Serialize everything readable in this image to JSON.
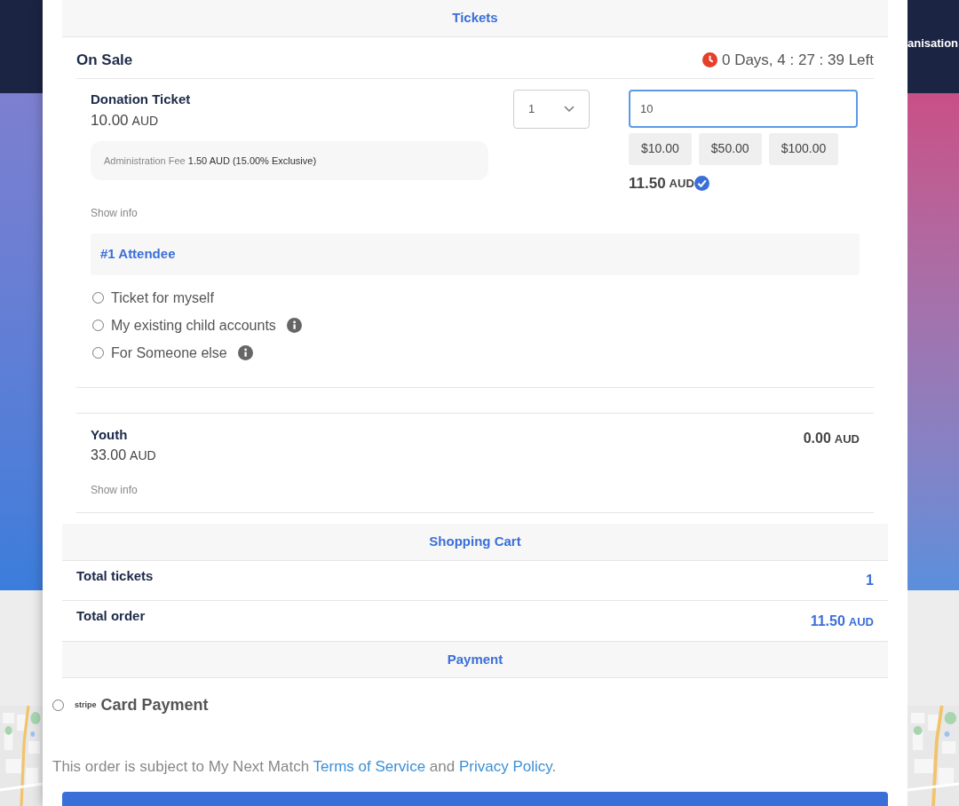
{
  "background": {
    "nav_text": "anisation"
  },
  "tickets_header": "Tickets",
  "section": {
    "title": "On Sale",
    "countdown": "0 Days, 4 : 27 : 39 Left"
  },
  "tickets": [
    {
      "kind": "donation",
      "name": "Donation Ticket",
      "price": "10.00",
      "currency": "AUD",
      "fee_label": "Administration Fee",
      "fee_value": "1.50 AUD (15.00% Exclusive)",
      "show_info": "Show info",
      "quantity": "1",
      "amount": "10",
      "presets": [
        "$10.00",
        "$50.00",
        "$100.00"
      ],
      "subtotal": "11.50",
      "subtotal_currency": "AUD",
      "attendee_title": "#1 Attendee",
      "attendee_options": [
        {
          "label": "Ticket for myself",
          "info": false,
          "selected": false
        },
        {
          "label": "My existing child accounts",
          "info": true,
          "selected": false
        },
        {
          "label": "For Someone else",
          "info": true,
          "selected": false
        }
      ]
    },
    {
      "kind": "standard",
      "name": "Youth",
      "price": "33.00",
      "currency": "AUD",
      "show_info": "Show info",
      "subtotal": "0.00",
      "subtotal_currency": "AUD"
    }
  ],
  "cart": {
    "title": "Shopping Cart",
    "rows": [
      {
        "label": "Total tickets",
        "value": "1"
      },
      {
        "label": "Total order",
        "value": "11.50",
        "currency": "AUD"
      }
    ]
  },
  "payment": {
    "title": "Payment",
    "methods": [
      {
        "brand": "stripe",
        "label": "Card Payment",
        "selected": false
      }
    ]
  },
  "terms": {
    "prefix": "This order is subject to My Next Match",
    "link1": "Terms of Service",
    "middle": "and",
    "link2": "Privacy Policy",
    "suffix": "."
  }
}
